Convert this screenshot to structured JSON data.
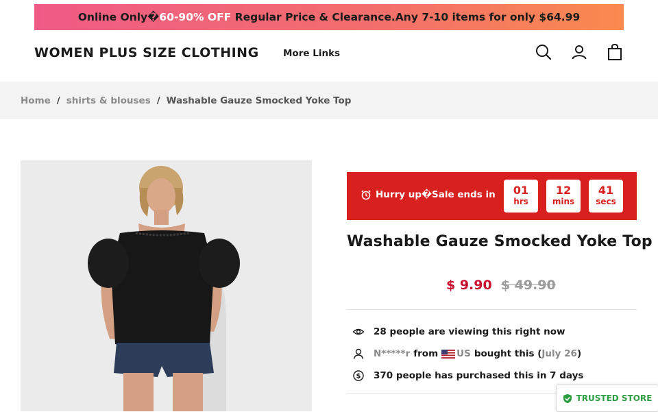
{
  "promo": {
    "prefix": "Online Only",
    "sep_glyph": "�",
    "highlight": "60-90% OFF",
    "suffix": " Regular Price & Clearance.Any 7-10 items for only $64.99"
  },
  "header": {
    "brand": "WOMEN PLUS SIZE CLOTHING",
    "more_links": "More Links",
    "icons": [
      "search-icon",
      "account-icon",
      "cart-icon"
    ]
  },
  "breadcrumb": {
    "items": [
      "Home",
      "shirts & blouses",
      "Washable Gauze Smocked Yoke Top"
    ],
    "separator": "/"
  },
  "product": {
    "title": "Washable Gauze Smocked Yoke Top",
    "price": "$ 9.90",
    "compare_price": "$ 49.90",
    "image_icon": "product-photo"
  },
  "sale_timer": {
    "label": "Hurry up�Sale ends in",
    "hours": "01",
    "hours_unit": "hrs",
    "minutes": "12",
    "minutes_unit": "mins",
    "seconds": "41",
    "seconds_unit": "secs",
    "color": "#d8201f"
  },
  "social_proof": {
    "viewing": "28 people are viewing this right now",
    "buyer_name": "N*****r",
    "from_text": "from",
    "country": "US",
    "bought_text": "bought this (",
    "bought_date": "July 26",
    "close_paren": ")",
    "purchased": "370 people has purchased this in 7 days"
  },
  "badge": {
    "text": "TRUSTED STORE"
  },
  "colors": {
    "accent_red": "#d8201f",
    "price_red": "#c8102e",
    "trusted_green": "#2e9e43",
    "promo_start": "#ef5b86",
    "promo_end": "#fa8a4f"
  }
}
